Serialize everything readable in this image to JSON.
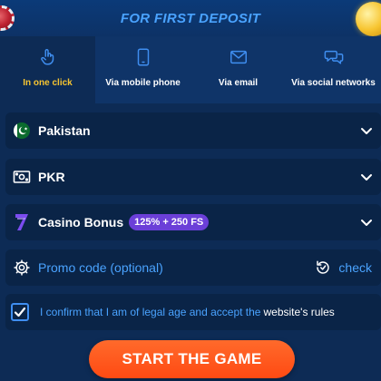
{
  "header": {
    "title": "FOR FIRST DEPOSIT"
  },
  "tabs": [
    {
      "label": "In one click",
      "icon": "pointer-hand-icon",
      "active": true
    },
    {
      "label": "Via mobile phone",
      "icon": "mobile-phone-icon",
      "active": false
    },
    {
      "label": "Via email",
      "icon": "envelope-icon",
      "active": false
    },
    {
      "label": "Via social networks",
      "icon": "chat-bubbles-icon",
      "active": false
    }
  ],
  "form": {
    "country": {
      "value": "Pakistan",
      "icon": "pakistan-flag-icon"
    },
    "currency": {
      "value": "PKR",
      "icon": "banknote-icon"
    },
    "bonus": {
      "value": "Casino Bonus",
      "badge": "125% + 250 FS",
      "icon": "casino-seven-icon"
    },
    "promo": {
      "placeholder": "Promo code (optional)",
      "check_label": "check"
    },
    "confirm": {
      "checked": true,
      "text": "I confirm that I am of legal age and accept the",
      "link": "website's rules"
    }
  },
  "cta": {
    "label": "START THE GAME"
  },
  "colors": {
    "background": "#0d2b55",
    "accent_blue": "#4aa3ff",
    "active_tab": "#f7c531",
    "badge": "#6b3fd8",
    "cta": "#ff4a13"
  }
}
